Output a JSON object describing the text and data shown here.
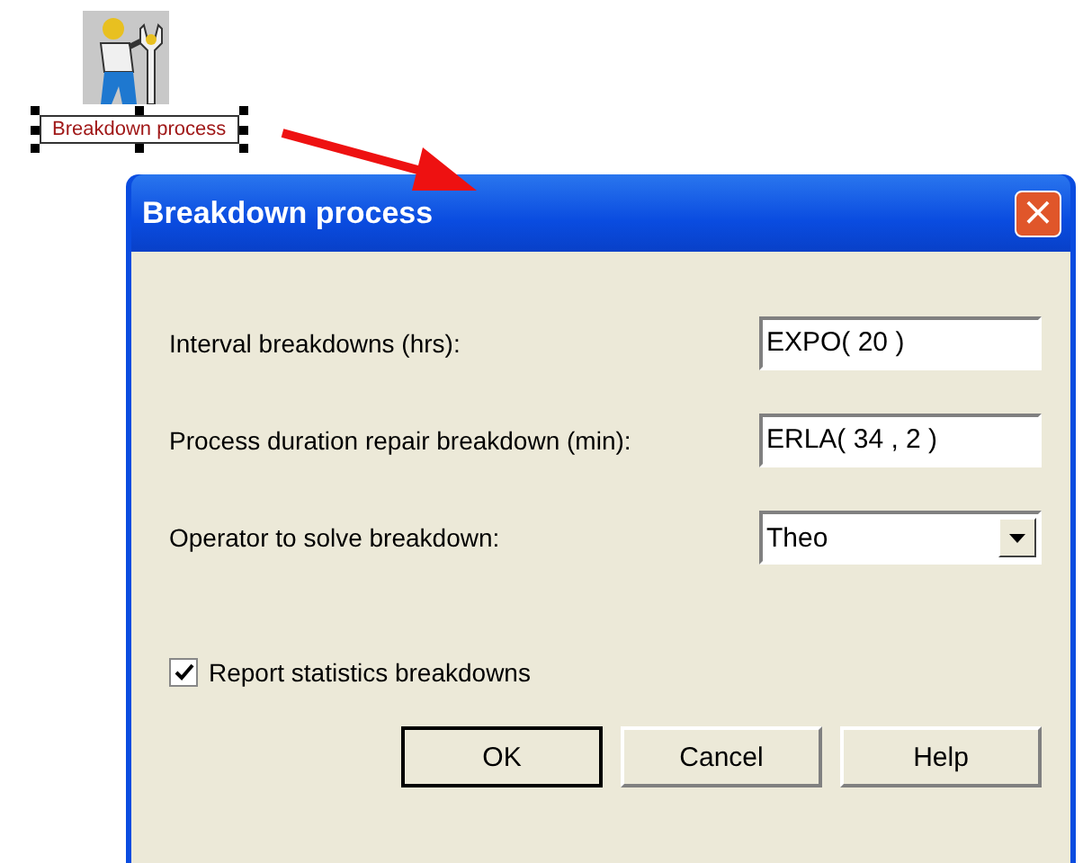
{
  "canvas": {
    "block_label": "Breakdown process",
    "block_selected": true
  },
  "dialog": {
    "title": "Breakdown process",
    "close": "×",
    "fields": [
      {
        "kind": "text",
        "label": "Interval breakdowns (hrs):",
        "value": "EXPO( 20 )"
      },
      {
        "kind": "text",
        "label": "Process duration repair breakdown (min):",
        "value": "ERLA( 34 , 2 )"
      },
      {
        "kind": "dropdown",
        "label": "Operator to solve breakdown:",
        "value": "Theo"
      }
    ],
    "checkbox": {
      "label": "Report statistics breakdowns",
      "checked": true
    },
    "buttons": [
      {
        "label": "OK",
        "default": true
      },
      {
        "label": "Cancel",
        "default": false
      },
      {
        "label": "Help",
        "default": false
      }
    ]
  }
}
